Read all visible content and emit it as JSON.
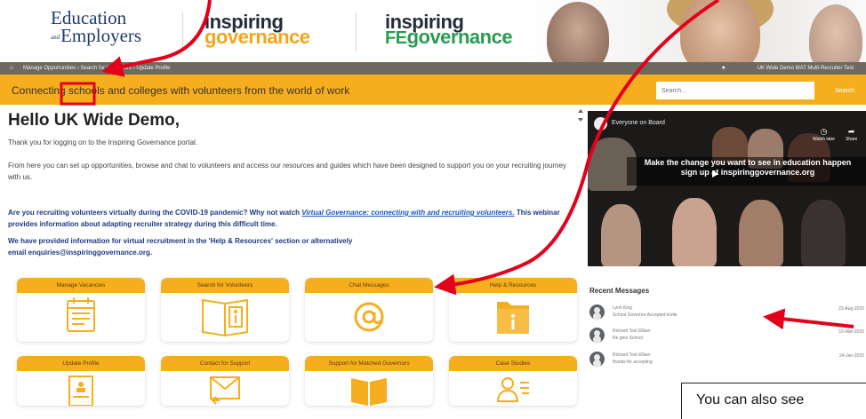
{
  "header": {
    "logo_ee_line1": "Education",
    "logo_ee_and": "and",
    "logo_ee_line2": "Employers",
    "logo_ig_line1": "inspiring",
    "logo_ig_line2": "governance",
    "logo_ige_line1": "inspiring",
    "logo_ige_fe": "FE",
    "logo_ige_line2": "governance"
  },
  "breadcrumb": {
    "home_icon": "home-icon",
    "trail": "Manage Opportunities › Search for Volunteers › Update Profile",
    "user": "UK Wide Demo MAT Multi-Recruiter Test"
  },
  "tagbar": {
    "tagline": "Connecting schools and colleges with volunteers from the world of work",
    "search_placeholder": "Search...",
    "search_button": "Search"
  },
  "main": {
    "greeting": "Hello UK Wide Demo,",
    "para1": "Thank you for logging on to the Inspiring Governance portal.",
    "para2": "From here you can set up opportunities, browse and chat to volunteers and access our resources and guides which have been designed to support you on your recruiting journey with us.",
    "covid_pre": "Are you recruiting volunteers virtually during the COVID-19 pandemic? Why not watch ",
    "covid_link": "Virtual Governance: connecting with and recruiting volunteers.",
    "covid_post": " This webinar provides information about adapting recruiter strategy during this difficult time.",
    "virtual_line1": "We have provided information for virtual recruitment in the 'Help & Resources' section or alternatively",
    "virtual_line2": "email enquiries@inspiringgovernance.org."
  },
  "tiles": [
    {
      "label": "Manage Vacancies",
      "icon": "calendar-list-icon"
    },
    {
      "label": "Search for Volunteers",
      "icon": "open-book-info-icon"
    },
    {
      "label": "Chat Messages",
      "icon": "at-sign-icon"
    },
    {
      "label": "Help & Resources",
      "icon": "folder-info-icon"
    },
    {
      "label": "Update Profile",
      "icon": "profile-document-icon"
    },
    {
      "label": "Contact for Support",
      "icon": "mail-reply-icon"
    },
    {
      "label": "Support for Matched Governors",
      "icon": "book-icon"
    },
    {
      "label": "Case Studies",
      "icon": "user-list-icon"
    }
  ],
  "video": {
    "title": "Everyone on Board",
    "caption_line1": "Make the change you want to see in education happen",
    "caption_line2": "sign up at inspiringgovernance.org",
    "watch_later": "Watch later",
    "share": "Share"
  },
  "recent_messages": {
    "title": "Recent Messages",
    "items": [
      {
        "name": "Lynn King",
        "subject": "School Governor Accepted Invite",
        "date": "23-Aug-2020"
      },
      {
        "name": "Richard Test Elliam",
        "subject": "Re gtes School",
        "date": "15-Mar-2020"
      },
      {
        "name": "Richard Test Elliam",
        "subject": "thanks for accepting",
        "date": "24-Jan-2020"
      }
    ]
  },
  "annotation": {
    "callout_text": "You can also see",
    "color": "#e3001b"
  },
  "colors": {
    "accent": "#f6ae1e",
    "navy": "#1f3b6e",
    "link": "#1b55c0",
    "annotation_red": "#e3001b"
  }
}
